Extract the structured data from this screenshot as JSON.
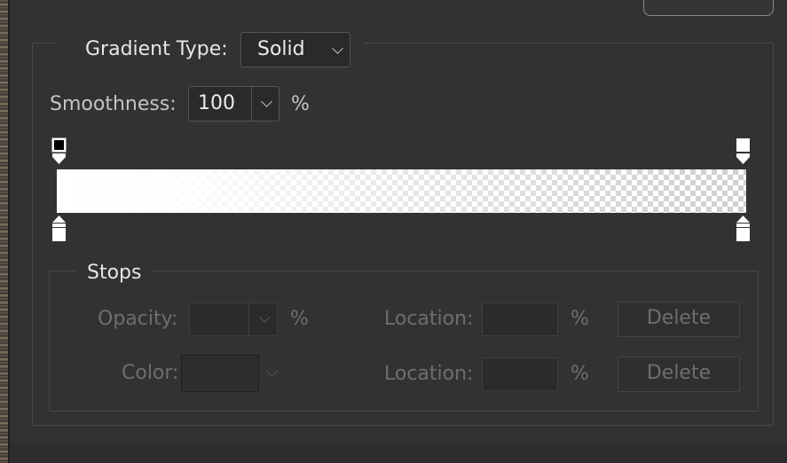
{
  "gradient_type": {
    "label": "Gradient Type:",
    "value": "Solid"
  },
  "smoothness": {
    "label": "Smoothness:",
    "value": "100",
    "unit": "%"
  },
  "stops": {
    "title": "Stops",
    "opacity": {
      "label": "Opacity:",
      "value": "",
      "unit": "%"
    },
    "color": {
      "label": "Color:"
    },
    "opacity_location": {
      "label": "Location:",
      "value": "",
      "unit": "%"
    },
    "color_location": {
      "label": "Location:",
      "value": "",
      "unit": "%"
    },
    "delete_label": "Delete"
  },
  "colors": {
    "background": "#323232",
    "border": "#4a4a4a",
    "disabled_text": "#6e6e6e"
  }
}
